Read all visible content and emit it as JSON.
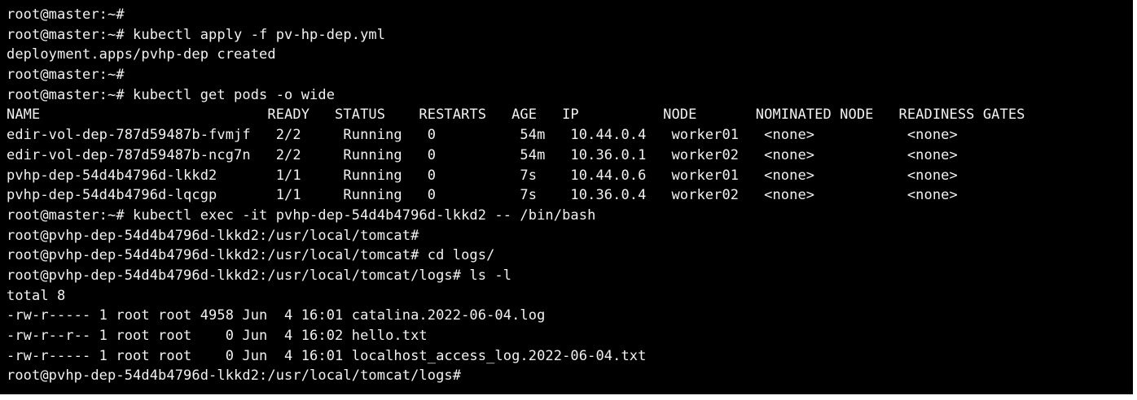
{
  "terminal": {
    "lines": [
      "root@master:~#",
      "root@master:~# kubectl apply -f pv-hp-dep.yml",
      "deployment.apps/pvhp-dep created",
      "root@master:~#",
      "root@master:~# kubectl get pods -o wide",
      "NAME                           READY   STATUS    RESTARTS   AGE   IP          NODE       NOMINATED NODE   READINESS GATES",
      "edir-vol-dep-787d59487b-fvmjf   2/2     Running   0          54m   10.44.0.4   worker01   <none>           <none>",
      "edir-vol-dep-787d59487b-ncg7n   2/2     Running   0          54m   10.36.0.1   worker02   <none>           <none>",
      "pvhp-dep-54d4b4796d-lkkd2       1/1     Running   0          7s    10.44.0.6   worker01   <none>           <none>",
      "pvhp-dep-54d4b4796d-lqcgp       1/1     Running   0          7s    10.36.0.4   worker02   <none>           <none>",
      "root@master:~# kubectl exec -it pvhp-dep-54d4b4796d-lkkd2 -- /bin/bash",
      "root@pvhp-dep-54d4b4796d-lkkd2:/usr/local/tomcat#",
      "root@pvhp-dep-54d4b4796d-lkkd2:/usr/local/tomcat# cd logs/",
      "root@pvhp-dep-54d4b4796d-lkkd2:/usr/local/tomcat/logs# ls -l",
      "total 8",
      "-rw-r----- 1 root root 4958 Jun  4 16:01 catalina.2022-06-04.log",
      "-rw-r--r-- 1 root root    0 Jun  4 16:02 hello.txt",
      "-rw-r----- 1 root root    0 Jun  4 16:01 localhost_access_log.2022-06-04.txt",
      "root@pvhp-dep-54d4b4796d-lkkd2:/usr/local/tomcat/logs#"
    ]
  }
}
